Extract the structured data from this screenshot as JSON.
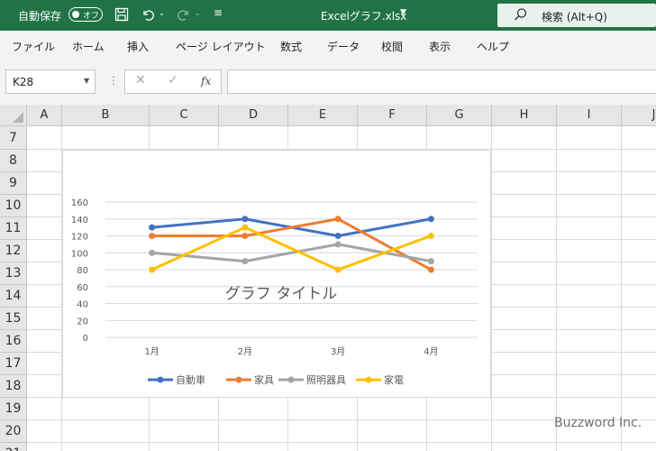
{
  "titlebar": {
    "autosave_label": "自動保存",
    "autosave_state": "オフ",
    "filename": "Excelグラフ.xlsx",
    "search_label": "検索 (Alt+Q)"
  },
  "menu": [
    "ファイル",
    "ホーム",
    "挿入",
    "ページ レイアウト",
    "数式",
    "データ",
    "校閲",
    "表示",
    "ヘルプ"
  ],
  "formula": {
    "namebox": "K28",
    "fx_label": "fx",
    "content": ""
  },
  "columns": [
    "A",
    "B",
    "C",
    "D",
    "E",
    "F",
    "G",
    "H",
    "I",
    "J"
  ],
  "rows": [
    "7",
    "8",
    "9",
    "10",
    "11",
    "12",
    "13",
    "14",
    "15",
    "16",
    "17",
    "18",
    "19",
    "20",
    "21"
  ],
  "chart_data": {
    "type": "line",
    "title": "グラフ タイトル",
    "categories": [
      "1月",
      "2月",
      "3月",
      "4月"
    ],
    "yticks": [
      "0",
      "20",
      "40",
      "60",
      "80",
      "100",
      "120",
      "140",
      "160"
    ],
    "ylim": [
      0,
      160
    ],
    "grid": true,
    "legend_position": "bottom",
    "series": [
      {
        "name": "自動車",
        "color": "#4472c4",
        "values": [
          130,
          140,
          120,
          140
        ]
      },
      {
        "name": "家具",
        "color": "#ed7d31",
        "values": [
          120,
          120,
          140,
          80
        ]
      },
      {
        "name": "照明器具",
        "color": "#a5a5a5",
        "values": [
          100,
          90,
          110,
          90
        ]
      },
      {
        "name": "家電",
        "color": "#ffc000",
        "values": [
          80,
          130,
          80,
          120
        ]
      }
    ]
  },
  "watermark": "Buzzword Inc."
}
